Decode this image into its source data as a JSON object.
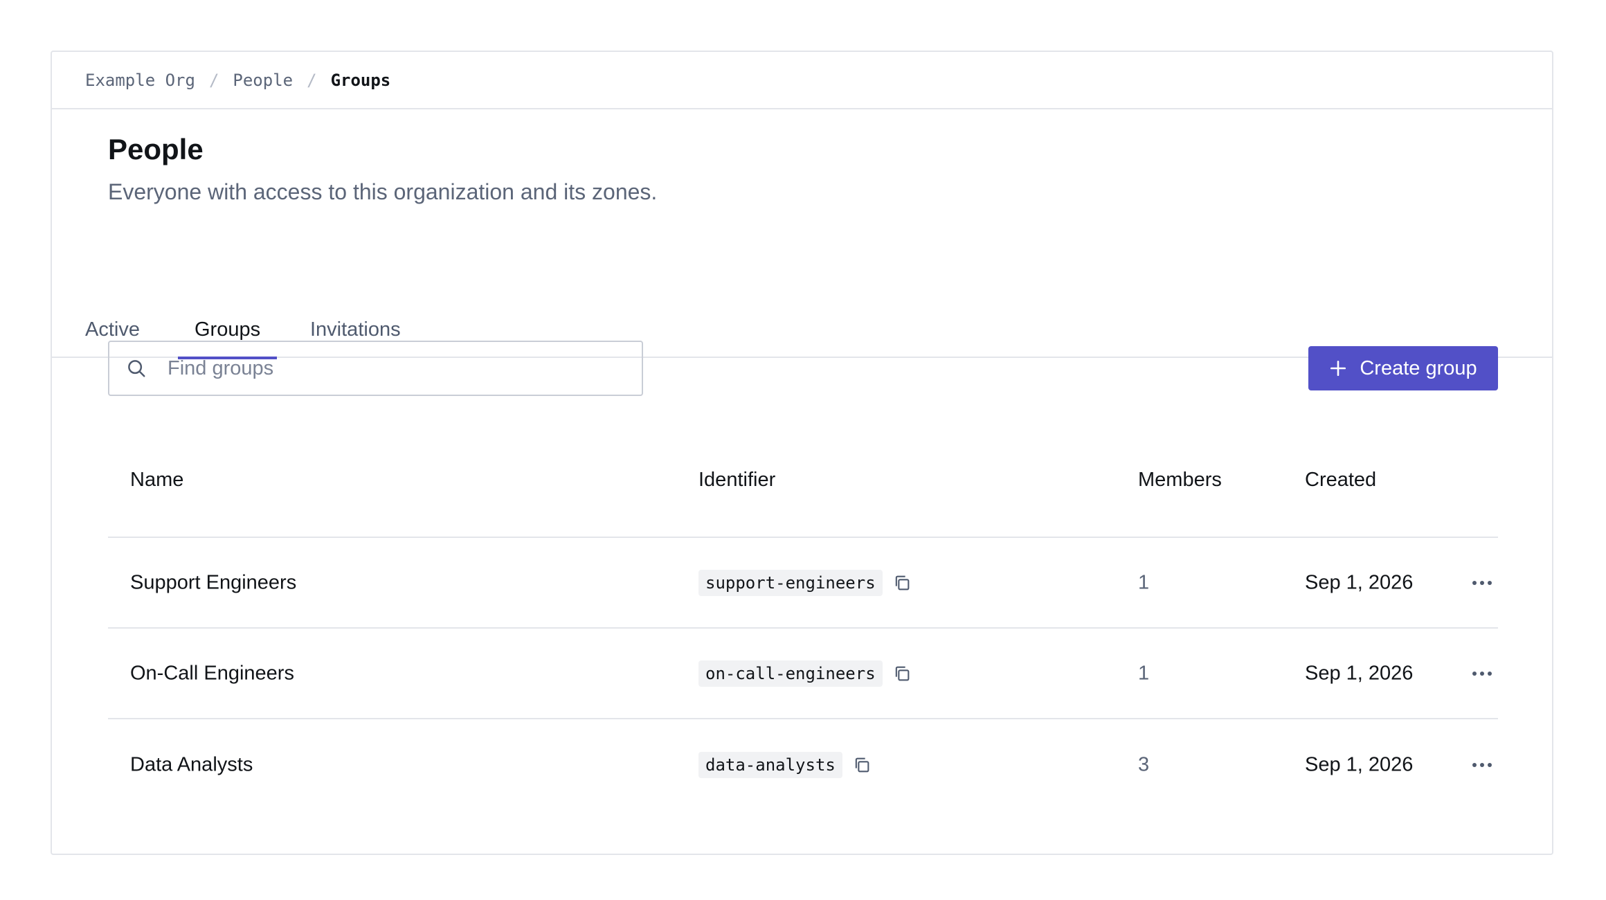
{
  "breadcrumb": {
    "items": [
      "Example Org",
      "People"
    ],
    "current": "Groups",
    "separator": "/"
  },
  "header": {
    "title": "People",
    "subtitle": "Everyone with access to this organization and its zones."
  },
  "tabs": [
    {
      "label": "Active",
      "active": false
    },
    {
      "label": "Groups",
      "active": true
    },
    {
      "label": "Invitations",
      "active": false
    }
  ],
  "search": {
    "placeholder": "Find groups",
    "value": "",
    "icon": "search-icon"
  },
  "create_button": {
    "label": "Create group",
    "icon": "plus-icon"
  },
  "table": {
    "columns": [
      "Name",
      "Identifier",
      "Members",
      "Created"
    ],
    "rows": [
      {
        "name": "Support Engineers",
        "identifier": "support-engineers",
        "members": "1",
        "created": "Sep 1, 2026"
      },
      {
        "name": "On-Call Engineers",
        "identifier": "on-call-engineers",
        "members": "1",
        "created": "Sep 1, 2026"
      },
      {
        "name": "Data Analysts",
        "identifier": "data-analysts",
        "members": "3",
        "created": "Sep 1, 2026"
      }
    ]
  },
  "colors": {
    "accent": "#5250c7",
    "border": "#e3e5ea",
    "muted_text": "#5b6578"
  }
}
